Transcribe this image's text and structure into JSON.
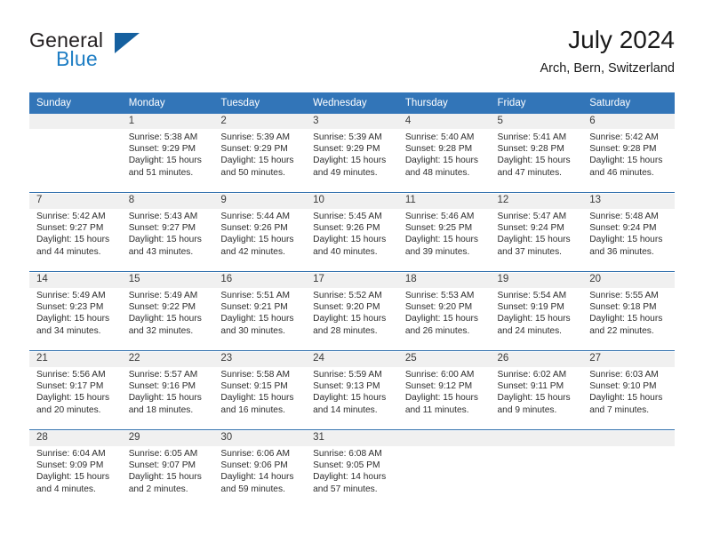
{
  "brand": {
    "name_part1": "General",
    "name_part2": "Blue",
    "triangle_color": "#15609f",
    "blue_color": "#1f7ec4"
  },
  "header": {
    "title": "July 2024",
    "subtitle": "Arch, Bern, Switzerland"
  },
  "theme": {
    "header_bg": "#3275b8",
    "row_divider": "#2b6cab",
    "daynum_band": "#f0f0f0"
  },
  "weekdays": [
    "Sunday",
    "Monday",
    "Tuesday",
    "Wednesday",
    "Thursday",
    "Friday",
    "Saturday"
  ],
  "weeks": [
    [
      {
        "day": "",
        "l1": "",
        "l2": "",
        "l3": "",
        "l4": ""
      },
      {
        "day": "1",
        "l1": "Sunrise: 5:38 AM",
        "l2": "Sunset: 9:29 PM",
        "l3": "Daylight: 15 hours",
        "l4": "and 51 minutes."
      },
      {
        "day": "2",
        "l1": "Sunrise: 5:39 AM",
        "l2": "Sunset: 9:29 PM",
        "l3": "Daylight: 15 hours",
        "l4": "and 50 minutes."
      },
      {
        "day": "3",
        "l1": "Sunrise: 5:39 AM",
        "l2": "Sunset: 9:29 PM",
        "l3": "Daylight: 15 hours",
        "l4": "and 49 minutes."
      },
      {
        "day": "4",
        "l1": "Sunrise: 5:40 AM",
        "l2": "Sunset: 9:28 PM",
        "l3": "Daylight: 15 hours",
        "l4": "and 48 minutes."
      },
      {
        "day": "5",
        "l1": "Sunrise: 5:41 AM",
        "l2": "Sunset: 9:28 PM",
        "l3": "Daylight: 15 hours",
        "l4": "and 47 minutes."
      },
      {
        "day": "6",
        "l1": "Sunrise: 5:42 AM",
        "l2": "Sunset: 9:28 PM",
        "l3": "Daylight: 15 hours",
        "l4": "and 46 minutes."
      }
    ],
    [
      {
        "day": "7",
        "l1": "Sunrise: 5:42 AM",
        "l2": "Sunset: 9:27 PM",
        "l3": "Daylight: 15 hours",
        "l4": "and 44 minutes."
      },
      {
        "day": "8",
        "l1": "Sunrise: 5:43 AM",
        "l2": "Sunset: 9:27 PM",
        "l3": "Daylight: 15 hours",
        "l4": "and 43 minutes."
      },
      {
        "day": "9",
        "l1": "Sunrise: 5:44 AM",
        "l2": "Sunset: 9:26 PM",
        "l3": "Daylight: 15 hours",
        "l4": "and 42 minutes."
      },
      {
        "day": "10",
        "l1": "Sunrise: 5:45 AM",
        "l2": "Sunset: 9:26 PM",
        "l3": "Daylight: 15 hours",
        "l4": "and 40 minutes."
      },
      {
        "day": "11",
        "l1": "Sunrise: 5:46 AM",
        "l2": "Sunset: 9:25 PM",
        "l3": "Daylight: 15 hours",
        "l4": "and 39 minutes."
      },
      {
        "day": "12",
        "l1": "Sunrise: 5:47 AM",
        "l2": "Sunset: 9:24 PM",
        "l3": "Daylight: 15 hours",
        "l4": "and 37 minutes."
      },
      {
        "day": "13",
        "l1": "Sunrise: 5:48 AM",
        "l2": "Sunset: 9:24 PM",
        "l3": "Daylight: 15 hours",
        "l4": "and 36 minutes."
      }
    ],
    [
      {
        "day": "14",
        "l1": "Sunrise: 5:49 AM",
        "l2": "Sunset: 9:23 PM",
        "l3": "Daylight: 15 hours",
        "l4": "and 34 minutes."
      },
      {
        "day": "15",
        "l1": "Sunrise: 5:49 AM",
        "l2": "Sunset: 9:22 PM",
        "l3": "Daylight: 15 hours",
        "l4": "and 32 minutes."
      },
      {
        "day": "16",
        "l1": "Sunrise: 5:51 AM",
        "l2": "Sunset: 9:21 PM",
        "l3": "Daylight: 15 hours",
        "l4": "and 30 minutes."
      },
      {
        "day": "17",
        "l1": "Sunrise: 5:52 AM",
        "l2": "Sunset: 9:20 PM",
        "l3": "Daylight: 15 hours",
        "l4": "and 28 minutes."
      },
      {
        "day": "18",
        "l1": "Sunrise: 5:53 AM",
        "l2": "Sunset: 9:20 PM",
        "l3": "Daylight: 15 hours",
        "l4": "and 26 minutes."
      },
      {
        "day": "19",
        "l1": "Sunrise: 5:54 AM",
        "l2": "Sunset: 9:19 PM",
        "l3": "Daylight: 15 hours",
        "l4": "and 24 minutes."
      },
      {
        "day": "20",
        "l1": "Sunrise: 5:55 AM",
        "l2": "Sunset: 9:18 PM",
        "l3": "Daylight: 15 hours",
        "l4": "and 22 minutes."
      }
    ],
    [
      {
        "day": "21",
        "l1": "Sunrise: 5:56 AM",
        "l2": "Sunset: 9:17 PM",
        "l3": "Daylight: 15 hours",
        "l4": "and 20 minutes."
      },
      {
        "day": "22",
        "l1": "Sunrise: 5:57 AM",
        "l2": "Sunset: 9:16 PM",
        "l3": "Daylight: 15 hours",
        "l4": "and 18 minutes."
      },
      {
        "day": "23",
        "l1": "Sunrise: 5:58 AM",
        "l2": "Sunset: 9:15 PM",
        "l3": "Daylight: 15 hours",
        "l4": "and 16 minutes."
      },
      {
        "day": "24",
        "l1": "Sunrise: 5:59 AM",
        "l2": "Sunset: 9:13 PM",
        "l3": "Daylight: 15 hours",
        "l4": "and 14 minutes."
      },
      {
        "day": "25",
        "l1": "Sunrise: 6:00 AM",
        "l2": "Sunset: 9:12 PM",
        "l3": "Daylight: 15 hours",
        "l4": "and 11 minutes."
      },
      {
        "day": "26",
        "l1": "Sunrise: 6:02 AM",
        "l2": "Sunset: 9:11 PM",
        "l3": "Daylight: 15 hours",
        "l4": "and 9 minutes."
      },
      {
        "day": "27",
        "l1": "Sunrise: 6:03 AM",
        "l2": "Sunset: 9:10 PM",
        "l3": "Daylight: 15 hours",
        "l4": "and 7 minutes."
      }
    ],
    [
      {
        "day": "28",
        "l1": "Sunrise: 6:04 AM",
        "l2": "Sunset: 9:09 PM",
        "l3": "Daylight: 15 hours",
        "l4": "and 4 minutes."
      },
      {
        "day": "29",
        "l1": "Sunrise: 6:05 AM",
        "l2": "Sunset: 9:07 PM",
        "l3": "Daylight: 15 hours",
        "l4": "and 2 minutes."
      },
      {
        "day": "30",
        "l1": "Sunrise: 6:06 AM",
        "l2": "Sunset: 9:06 PM",
        "l3": "Daylight: 14 hours",
        "l4": "and 59 minutes."
      },
      {
        "day": "31",
        "l1": "Sunrise: 6:08 AM",
        "l2": "Sunset: 9:05 PM",
        "l3": "Daylight: 14 hours",
        "l4": "and 57 minutes."
      },
      {
        "day": "",
        "l1": "",
        "l2": "",
        "l3": "",
        "l4": ""
      },
      {
        "day": "",
        "l1": "",
        "l2": "",
        "l3": "",
        "l4": ""
      },
      {
        "day": "",
        "l1": "",
        "l2": "",
        "l3": "",
        "l4": ""
      }
    ]
  ]
}
